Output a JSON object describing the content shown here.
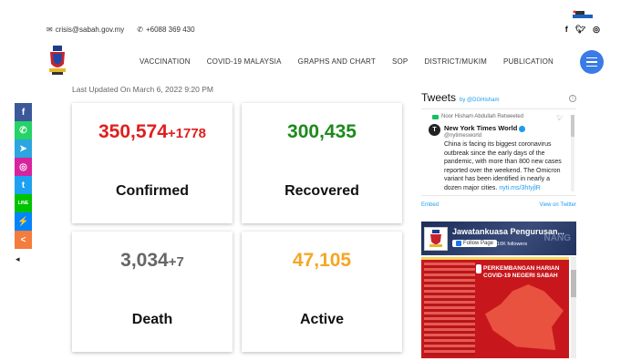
{
  "header": {
    "email": "crisis@sabah.gov.my",
    "phone": "+6088 369 430",
    "social_top": [
      "f",
      "t",
      "ig"
    ]
  },
  "nav": {
    "items": [
      "VACCINATION",
      "COVID-19 MALAYSIA",
      "GRAPHS AND CHART",
      "SOP",
      "DISTRICT/MUKIM",
      "PUBLICATION"
    ]
  },
  "updated": "Last Updated On March 6, 2022 9:20 PM",
  "stats": {
    "confirmed": {
      "value": "350,574",
      "delta": "+1778",
      "label": "Confirmed",
      "color": "#e01e1e"
    },
    "recovered": {
      "value": "300,435",
      "delta": "",
      "label": "Recovered",
      "color": "#1c8a1c"
    },
    "death": {
      "value": "3,034",
      "delta": "+7",
      "label": "Death",
      "color": "#666666"
    },
    "active": {
      "value": "47,105",
      "delta": "",
      "label": "Active",
      "color": "#f5a623"
    }
  },
  "share": {
    "buttons": [
      {
        "icon": "facebook-icon",
        "color": "#3b5998",
        "glyph": "f"
      },
      {
        "icon": "whatsapp-icon",
        "color": "#25d366",
        "glyph": "✆"
      },
      {
        "icon": "telegram-icon",
        "color": "#2ca5e0",
        "glyph": "➤"
      },
      {
        "icon": "instagram-icon",
        "color": "#d6249f",
        "glyph": "◎"
      },
      {
        "icon": "twitter-icon",
        "color": "#1da1f2",
        "glyph": "t"
      },
      {
        "icon": "line-icon",
        "color": "#00c300",
        "glyph": "LINE"
      },
      {
        "icon": "messenger-icon",
        "color": "#0084ff",
        "glyph": "⚡"
      },
      {
        "icon": "share-icon",
        "color": "#f47c3c",
        "glyph": "<"
      }
    ],
    "collapse": "◂"
  },
  "tweets": {
    "title": "Tweets",
    "by": "by @DGHisham",
    "retweeted_by": "Noor Hisham Abdullah Retweeted",
    "author_name": "New York Times World",
    "author_handle": "@nytimesworld",
    "avatar_glyph": "T",
    "text": "China is facing its biggest coronavirus outbreak since the early days of the pandemic, with more than 800 new cases reported over the weekend. The Omicron variant has been identified in nearly a dozen major cities.",
    "link": "nyti.ms/3hIyjlR",
    "embed": "Embed",
    "view_on": "View on Twitter"
  },
  "facebook": {
    "page_name": "Jawatankuasa Pengurusan...",
    "follow_label": "Follow Page",
    "followers": "316K followers",
    "post_title": "PERKEMBANGAN HARIAN COVID-19 NEGERI SABAH",
    "cover_text": "NANG"
  }
}
